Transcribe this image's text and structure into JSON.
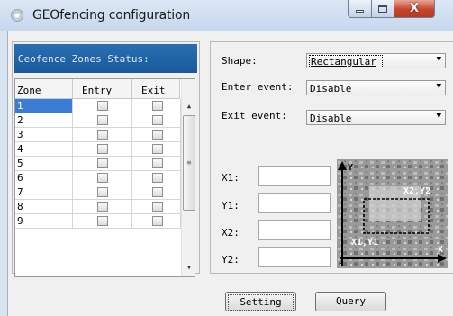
{
  "window": {
    "title": "GEOfencing configuration",
    "close_glyph": "X"
  },
  "zones_panel": {
    "header": "Geofence Zones Status:",
    "columns": [
      "Zone",
      "Entry",
      "Exit"
    ],
    "rows": [
      {
        "zone": "1",
        "entry": false,
        "exit": false,
        "selected": true
      },
      {
        "zone": "2",
        "entry": false,
        "exit": false,
        "selected": false
      },
      {
        "zone": "3",
        "entry": false,
        "exit": false,
        "selected": false
      },
      {
        "zone": "4",
        "entry": false,
        "exit": false,
        "selected": false
      },
      {
        "zone": "5",
        "entry": false,
        "exit": false,
        "selected": false
      },
      {
        "zone": "6",
        "entry": false,
        "exit": false,
        "selected": false
      },
      {
        "zone": "7",
        "entry": false,
        "exit": false,
        "selected": false
      },
      {
        "zone": "8",
        "entry": false,
        "exit": false,
        "selected": false
      },
      {
        "zone": "9",
        "entry": false,
        "exit": false,
        "selected": false
      }
    ]
  },
  "config": {
    "shape_label": "Shape:",
    "shape_value": "Rectangular",
    "enter_label": "Enter event:",
    "enter_value": "Disable",
    "exit_label": "Exit event:",
    "exit_value": "Disable",
    "x1_label": "X1:",
    "y1_label": "Y1:",
    "x2_label": "X2:",
    "y2_label": "Y2:",
    "x1_value": "",
    "y1_value": "",
    "x2_value": "",
    "y2_value": ""
  },
  "diagram": {
    "y_axis": "Y",
    "x_axis": "X",
    "origin": "0",
    "corner_top_right": "X2,Y2",
    "corner_bottom_left": "X1,Y1"
  },
  "buttons": {
    "setting": "Setting",
    "query": "Query"
  },
  "colors": {
    "header_blue": "#1f64a6",
    "selection_blue": "#3a7bd5",
    "close_red": "#c7442b"
  }
}
